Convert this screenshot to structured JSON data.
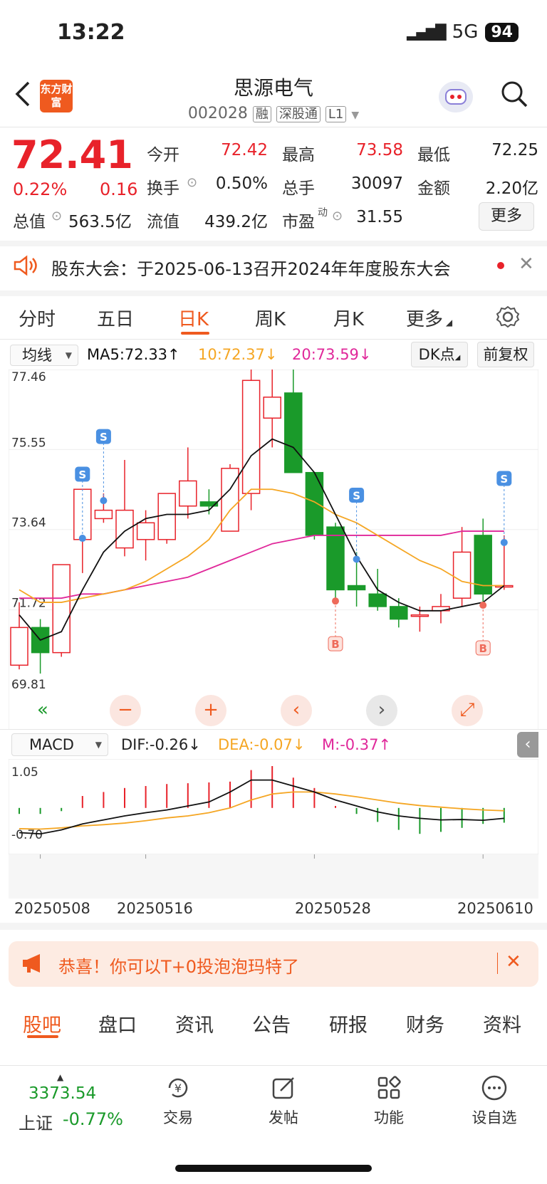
{
  "status": {
    "time": "13:22",
    "network": "5G",
    "battery": "94"
  },
  "header": {
    "logo_text": "东方财富",
    "name": "思源电气",
    "code": "002028",
    "tags": [
      "融",
      "深股通",
      "L1"
    ]
  },
  "quote": {
    "price": "72.41",
    "change_pct": "0.22%",
    "change": "0.16",
    "rows": [
      [
        {
          "label": "今开",
          "value": "72.42",
          "color": "red"
        },
        {
          "label": "最高",
          "value": "73.58",
          "color": "red"
        },
        {
          "label": "最低",
          "value": "72.25",
          "color": "dark"
        }
      ],
      [
        {
          "label": "换手",
          "value": "0.50%",
          "color": "dark"
        },
        {
          "label": "总手",
          "value": "30097",
          "color": "dark"
        },
        {
          "label": "金额",
          "value": "2.20亿",
          "color": "dark"
        }
      ],
      [
        {
          "label": "总值",
          "value": "563.5亿",
          "color": "dark"
        },
        {
          "label": "流值",
          "value": "439.2亿",
          "color": "dark"
        },
        {
          "label": "市盈",
          "value": "31.55",
          "color": "dark"
        }
      ]
    ],
    "pe_superscript": "动",
    "more_label": "更多"
  },
  "notice": {
    "text": "股东大会：于2025-06-13召开2024年年度股东大会"
  },
  "tabs": [
    "分时",
    "五日",
    "日K",
    "周K",
    "月K",
    "更多"
  ],
  "active_tab": "日K",
  "indicators": {
    "ma_select": "均线",
    "ma5": "MA5:72.33",
    "ma10": "10:72.37",
    "ma20": "20:73.59",
    "dk_label": "DK点",
    "fq_label": "前复权"
  },
  "chart_data": [
    {
      "type": "candlestick",
      "y_ticks": [
        "77.46",
        "75.55",
        "73.64",
        "71.72",
        "69.81"
      ],
      "ylim": [
        69.81,
        77.46
      ],
      "colors": {
        "up": "#e8222a",
        "down": "#1a9a2a",
        "ma5": "#111111",
        "ma10": "#f5a623",
        "ma20": "#e0289a"
      },
      "candles": [
        {
          "o": 70.4,
          "h": 71.9,
          "l": 70.3,
          "c": 71.3
        },
        {
          "o": 71.3,
          "h": 71.5,
          "l": 70.2,
          "c": 70.7
        },
        {
          "o": 70.7,
          "h": 72.8,
          "l": 70.6,
          "c": 72.8
        },
        {
          "o": 73.4,
          "h": 73.6,
          "l": 72.6,
          "c": 74.6
        },
        {
          "o": 73.9,
          "h": 74.5,
          "l": 73.8,
          "c": 74.1
        },
        {
          "o": 73.2,
          "h": 75.3,
          "l": 73.0,
          "c": 74.1
        },
        {
          "o": 73.4,
          "h": 74.1,
          "l": 72.9,
          "c": 73.8
        },
        {
          "o": 73.4,
          "h": 74.3,
          "l": 73.3,
          "c": 74.5
        },
        {
          "o": 74.2,
          "h": 75.6,
          "l": 73.9,
          "c": 74.8
        },
        {
          "o": 74.3,
          "h": 74.6,
          "l": 74.0,
          "c": 74.2
        },
        {
          "o": 73.6,
          "h": 75.2,
          "l": 73.6,
          "c": 75.1
        },
        {
          "o": 74.5,
          "h": 77.5,
          "l": 74.1,
          "c": 77.2
        },
        {
          "o": 76.3,
          "h": 77.5,
          "l": 75.6,
          "c": 76.8
        },
        {
          "o": 76.9,
          "h": 77.5,
          "l": 75.1,
          "c": 75.0
        },
        {
          "o": 75.0,
          "h": 75.0,
          "l": 73.4,
          "c": 73.5
        },
        {
          "o": 73.7,
          "h": 73.8,
          "l": 72.0,
          "c": 72.2
        },
        {
          "o": 72.3,
          "h": 73.1,
          "l": 71.8,
          "c": 72.2
        },
        {
          "o": 72.1,
          "h": 72.7,
          "l": 71.7,
          "c": 71.8
        },
        {
          "o": 71.8,
          "h": 72.0,
          "l": 71.3,
          "c": 71.5
        },
        {
          "o": 71.6,
          "h": 71.8,
          "l": 71.2,
          "c": 71.6
        },
        {
          "o": 71.7,
          "h": 72.1,
          "l": 71.4,
          "c": 71.8
        },
        {
          "o": 72.0,
          "h": 73.7,
          "l": 71.8,
          "c": 73.1
        },
        {
          "o": 73.5,
          "h": 73.9,
          "l": 71.9,
          "c": 72.1
        },
        {
          "o": 72.3,
          "h": 73.5,
          "l": 72.2,
          "c": 72.3
        }
      ],
      "ma5": [
        71.6,
        71.0,
        71.2,
        72.2,
        73.1,
        73.6,
        73.9,
        74.0,
        74.0,
        74.1,
        74.6,
        75.4,
        75.8,
        75.6,
        75.0,
        74.0,
        73.0,
        72.2,
        71.9,
        71.7,
        71.7,
        71.8,
        71.9,
        72.3
      ],
      "ma10": [
        72.2,
        71.9,
        71.9,
        72.0,
        72.1,
        72.2,
        72.4,
        72.7,
        73.0,
        73.4,
        74.1,
        74.6,
        74.6,
        74.5,
        74.3,
        74.0,
        73.8,
        73.5,
        73.2,
        72.9,
        72.7,
        72.4,
        72.3,
        72.3
      ],
      "ma20": [
        72.0,
        72.0,
        72.0,
        72.1,
        72.1,
        72.2,
        72.3,
        72.4,
        72.5,
        72.7,
        72.9,
        73.1,
        73.3,
        73.4,
        73.5,
        73.5,
        73.5,
        73.5,
        73.5,
        73.5,
        73.5,
        73.6,
        73.6,
        73.6
      ],
      "signals": [
        {
          "index": 3,
          "type": "S"
        },
        {
          "index": 4,
          "type": "S"
        },
        {
          "index": 15,
          "type": "B"
        },
        {
          "index": 16,
          "type": "S"
        },
        {
          "index": 22,
          "type": "B"
        },
        {
          "index": 23,
          "type": "S"
        }
      ]
    },
    {
      "type": "macd",
      "y_ticks": [
        "1.05",
        "-0.70"
      ],
      "ylim": [
        -0.7,
        1.05
      ],
      "bars": [
        -0.15,
        -0.15,
        -0.08,
        0.3,
        0.4,
        0.5,
        0.55,
        0.6,
        0.62,
        0.64,
        0.66,
        0.95,
        1.05,
        0.76,
        0.5,
        0.05,
        -0.15,
        -0.35,
        -0.55,
        -0.65,
        -0.6,
        -0.5,
        -0.4,
        -0.37
      ],
      "dif": [
        -0.62,
        -0.65,
        -0.55,
        -0.4,
        -0.3,
        -0.2,
        -0.12,
        -0.05,
        0.05,
        0.15,
        0.4,
        0.7,
        0.7,
        0.55,
        0.4,
        0.2,
        0.05,
        -0.1,
        -0.2,
        -0.26,
        -0.3,
        -0.29,
        -0.31,
        -0.26
      ],
      "dea": [
        -0.52,
        -0.53,
        -0.5,
        -0.45,
        -0.42,
        -0.38,
        -0.32,
        -0.25,
        -0.2,
        -0.12,
        0.0,
        0.2,
        0.35,
        0.4,
        0.4,
        0.35,
        0.28,
        0.2,
        0.12,
        0.06,
        0.02,
        -0.02,
        -0.05,
        -0.07
      ]
    }
  ],
  "macd": {
    "select": "MACD",
    "dif": "DIF:-0.26",
    "dea": "DEA:-0.07",
    "m": "M:-0.37"
  },
  "dates": [
    "20250508",
    "20250516",
    "20250528",
    "20250610"
  ],
  "promo": {
    "text": "恭喜！你可以T+0投泡泡玛特了"
  },
  "bottom_tabs": [
    "股吧",
    "盘口",
    "资讯",
    "公告",
    "研报",
    "财务",
    "资料"
  ],
  "index": {
    "value": "3373.54",
    "name": "上证",
    "pct": "-0.77%"
  },
  "nav": [
    "交易",
    "发帖",
    "功能",
    "设自选"
  ]
}
